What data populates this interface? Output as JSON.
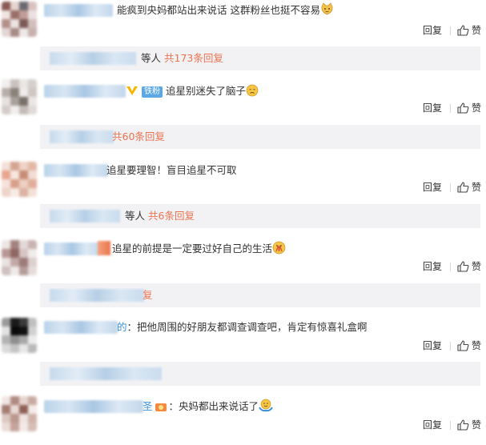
{
  "comments": [
    {
      "text": "能疯到央妈都站出来说话 这群粉丝也挺不容易",
      "emoji": "cat-face-emoji",
      "reply": "回复",
      "like": "赞",
      "sub_count": "共173条回复",
      "sub_prefix": "等人"
    },
    {
      "badge": "铁粉",
      "text": "追星别迷失了脑子",
      "emoji": "sad-face-emoji",
      "reply": "回复",
      "like": "赞",
      "sub_count": "共60条回复"
    },
    {
      "text": "追星要理智！盲目追星不可取",
      "reply": "回复",
      "like": "赞",
      "sub_count": "共6条回复",
      "sub_prefix": "等人"
    },
    {
      "text": "追星的前提是一定要过好自己的生活",
      "emoji": "pray-emoji",
      "reply": "回复",
      "like": "赞",
      "sub_tail": "复"
    },
    {
      "text": "把他周围的好朋友都调查调查吧，肯定有惊喜礼盒啊",
      "name_tail": "的",
      "reply": "回复",
      "like": "赞"
    },
    {
      "text": "央妈都出来说话了",
      "emoji": "hug-emoji",
      "name_tail": "圣",
      "reply": "回复",
      "like": "赞"
    }
  ],
  "colors": {
    "link": "#eb7350",
    "blue": "#3b8fd9",
    "subbox": "#f2f2f5"
  }
}
